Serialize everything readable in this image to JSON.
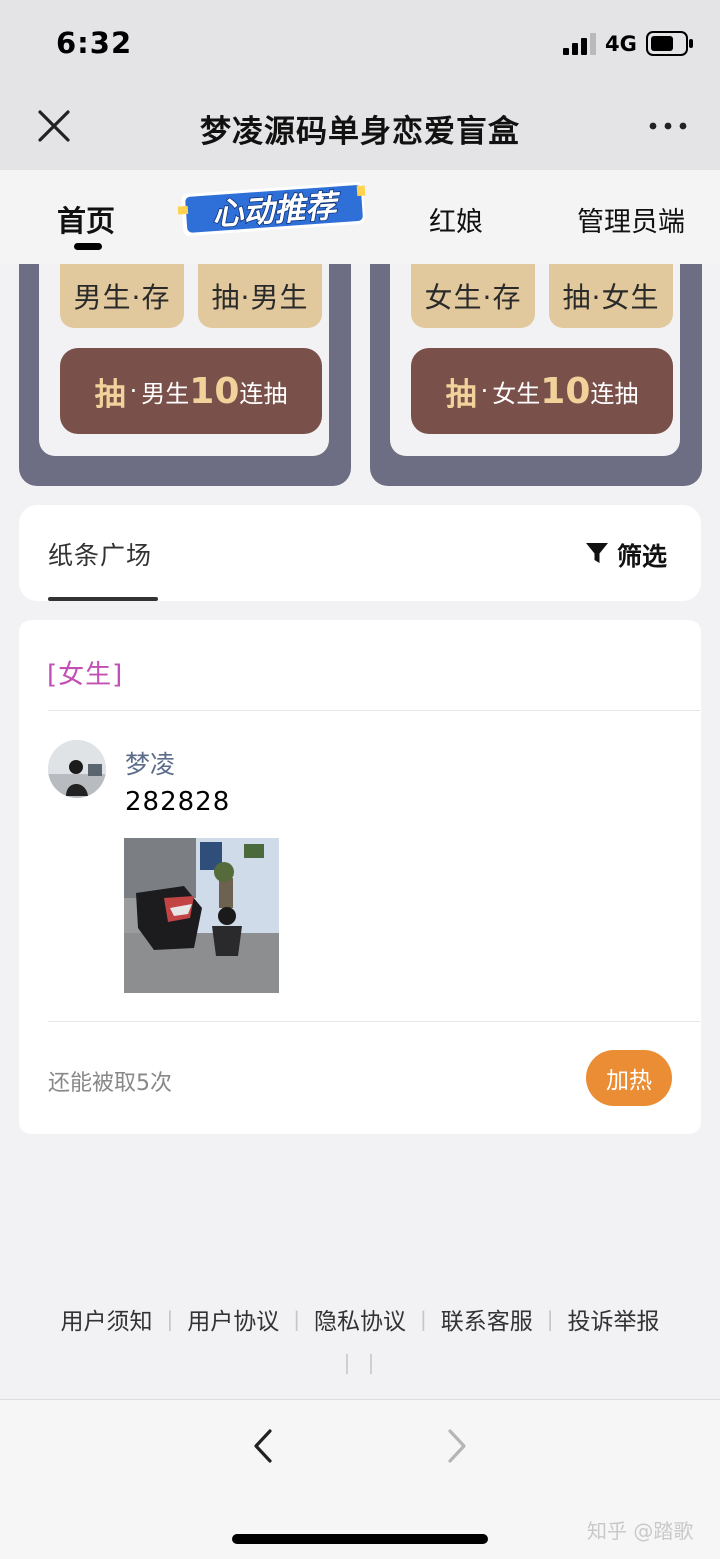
{
  "status_bar": {
    "time": "6:32",
    "network": "4G",
    "icons": [
      "signal-icon",
      "battery-icon"
    ]
  },
  "title_bar": {
    "title": "梦凌源码单身恋爱盲盒",
    "icons": [
      "close-icon",
      "more-icon"
    ]
  },
  "nav": {
    "tabs": [
      {
        "label": "首页",
        "active": true
      },
      {
        "label": "心动推荐",
        "style": "graphic-logo"
      },
      {
        "label": "红娘"
      },
      {
        "label": "管理员端"
      }
    ]
  },
  "boxes": {
    "male": {
      "store_label": "男生·存",
      "draw_label": "抽·男生",
      "draw10": {
        "prefix": "抽",
        "dot": "·",
        "who": "男生",
        "count": "10",
        "suffix": "连抽"
      }
    },
    "female": {
      "store_label": "女生·存",
      "draw_label": "抽·女生",
      "draw10": {
        "prefix": "抽",
        "dot": "·",
        "who": "女生",
        "count": "10",
        "suffix": "连抽"
      }
    }
  },
  "square": {
    "title": "纸条广场",
    "filter_label": "筛选",
    "filter_icon": "filter-icon"
  },
  "note": {
    "gender_tag": "[女生]",
    "username": "梦凌",
    "contact": "282828",
    "remaining": "还能被取5次",
    "heat_button": "加热"
  },
  "footer": {
    "links": [
      "用户须知",
      "用户协议",
      "隐私协议",
      "联系客服",
      "投诉举报"
    ]
  },
  "browser": {
    "icons": [
      "back-icon",
      "forward-icon"
    ],
    "watermark": "知乎 @踏歌"
  },
  "colors": {
    "accent_orange": "#ea8d35",
    "gender_tag": "#c250b4",
    "panel": "#6d6d84",
    "pill": "#e2c99d",
    "draw10": "#7a504b"
  }
}
